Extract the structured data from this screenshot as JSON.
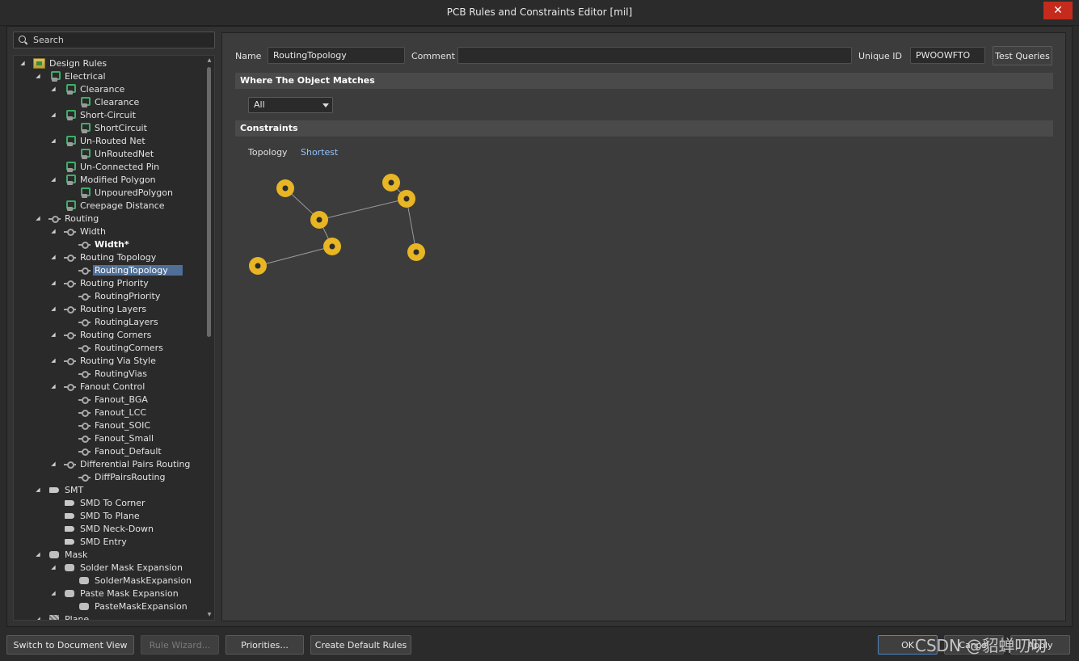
{
  "window": {
    "title": "PCB Rules and Constraints Editor [mil]",
    "close_label": "✕"
  },
  "search": {
    "placeholder": "Search"
  },
  "tree": [
    {
      "label": "Design Rules",
      "level": 0,
      "icon": "folder",
      "expanded": true
    },
    {
      "label": "Electrical",
      "level": 1,
      "icon": "elec",
      "expanded": true
    },
    {
      "label": "Clearance",
      "level": 2,
      "icon": "elec",
      "expanded": true
    },
    {
      "label": "Clearance",
      "level": 3,
      "icon": "elec"
    },
    {
      "label": "Short-Circuit",
      "level": 2,
      "icon": "elec",
      "expanded": true
    },
    {
      "label": "ShortCircuit",
      "level": 3,
      "icon": "elec"
    },
    {
      "label": "Un-Routed Net",
      "level": 2,
      "icon": "elec",
      "expanded": true
    },
    {
      "label": "UnRoutedNet",
      "level": 3,
      "icon": "elec"
    },
    {
      "label": "Un-Connected Pin",
      "level": 2,
      "icon": "elec"
    },
    {
      "label": "Modified Polygon",
      "level": 2,
      "icon": "elec",
      "expanded": true
    },
    {
      "label": "UnpouredPolygon",
      "level": 3,
      "icon": "elec"
    },
    {
      "label": "Creepage Distance",
      "level": 2,
      "icon": "elec"
    },
    {
      "label": "Routing",
      "level": 1,
      "icon": "route",
      "expanded": true
    },
    {
      "label": "Width",
      "level": 2,
      "icon": "route",
      "expanded": true
    },
    {
      "label": "Width*",
      "level": 3,
      "icon": "route",
      "bold": true
    },
    {
      "label": "Routing Topology",
      "level": 2,
      "icon": "route",
      "expanded": true
    },
    {
      "label": "RoutingTopology",
      "level": 3,
      "icon": "route",
      "selected": true
    },
    {
      "label": "Routing Priority",
      "level": 2,
      "icon": "route",
      "expanded": true
    },
    {
      "label": "RoutingPriority",
      "level": 3,
      "icon": "route"
    },
    {
      "label": "Routing Layers",
      "level": 2,
      "icon": "route",
      "expanded": true
    },
    {
      "label": "RoutingLayers",
      "level": 3,
      "icon": "route"
    },
    {
      "label": "Routing Corners",
      "level": 2,
      "icon": "route",
      "expanded": true
    },
    {
      "label": "RoutingCorners",
      "level": 3,
      "icon": "route"
    },
    {
      "label": "Routing Via Style",
      "level": 2,
      "icon": "route",
      "expanded": true
    },
    {
      "label": "RoutingVias",
      "level": 3,
      "icon": "route"
    },
    {
      "label": "Fanout Control",
      "level": 2,
      "icon": "route",
      "expanded": true
    },
    {
      "label": "Fanout_BGA",
      "level": 3,
      "icon": "route"
    },
    {
      "label": "Fanout_LCC",
      "level": 3,
      "icon": "route"
    },
    {
      "label": "Fanout_SOIC",
      "level": 3,
      "icon": "route"
    },
    {
      "label": "Fanout_Small",
      "level": 3,
      "icon": "route"
    },
    {
      "label": "Fanout_Default",
      "level": 3,
      "icon": "route"
    },
    {
      "label": "Differential Pairs Routing",
      "level": 2,
      "icon": "route",
      "expanded": true
    },
    {
      "label": "DiffPairsRouting",
      "level": 3,
      "icon": "route"
    },
    {
      "label": "SMT",
      "level": 1,
      "icon": "smt",
      "expanded": true
    },
    {
      "label": "SMD To Corner",
      "level": 2,
      "icon": "smt"
    },
    {
      "label": "SMD To Plane",
      "level": 2,
      "icon": "smt"
    },
    {
      "label": "SMD Neck-Down",
      "level": 2,
      "icon": "smt"
    },
    {
      "label": "SMD Entry",
      "level": 2,
      "icon": "smt"
    },
    {
      "label": "Mask",
      "level": 1,
      "icon": "mask",
      "expanded": true
    },
    {
      "label": "Solder Mask Expansion",
      "level": 2,
      "icon": "mask",
      "expanded": true
    },
    {
      "label": "SolderMaskExpansion",
      "level": 3,
      "icon": "mask"
    },
    {
      "label": "Paste Mask Expansion",
      "level": 2,
      "icon": "mask",
      "expanded": true
    },
    {
      "label": "PasteMaskExpansion",
      "level": 3,
      "icon": "mask"
    },
    {
      "label": "Plane",
      "level": 1,
      "icon": "plane",
      "expanded": true
    }
  ],
  "rule": {
    "name_label": "Name",
    "name_value": "RoutingTopology",
    "comment_label": "Comment",
    "comment_value": "",
    "uid_label": "Unique ID",
    "uid_value": "PWOOWFTO",
    "test_queries_label": "Test Queries"
  },
  "where_matches": {
    "header": "Where The Object Matches",
    "selected": "All"
  },
  "constraints": {
    "header": "Constraints",
    "topology_label": "Topology",
    "topology_value": "Shortest"
  },
  "colors": {
    "pad": "#e8b524",
    "pad_hole": "#2d2d2d",
    "wire": "#9a9a9a",
    "link": "#8fc3ff",
    "selection": "#4f6f97",
    "close": "#c42b1c"
  },
  "buttons": {
    "switch_view": "Switch to Document View",
    "rule_wizard": "Rule Wizard...",
    "priorities": "Priorities...",
    "create_default": "Create Default Rules",
    "ok": "OK",
    "cancel": "Cancel",
    "apply": "Apply"
  },
  "watermark": "CSDN @貂蝉叨叨"
}
